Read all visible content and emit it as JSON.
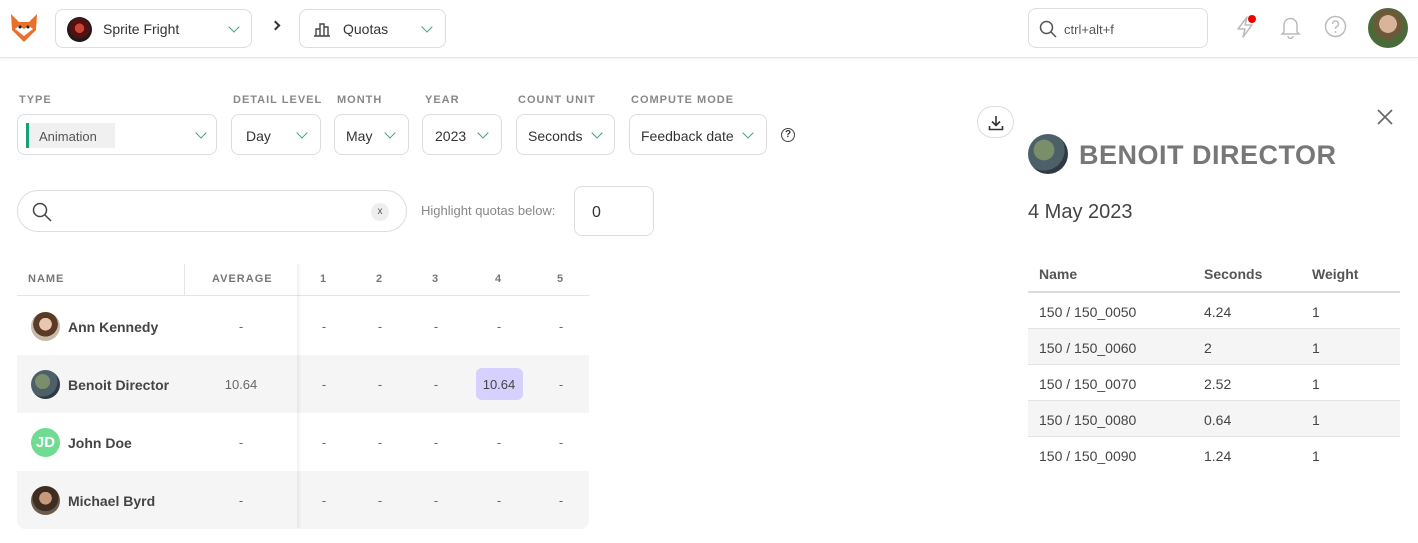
{
  "topbar": {
    "production": "Sprite Fright",
    "section": "Quotas",
    "search_placeholder": "ctrl+alt+f"
  },
  "filters": {
    "type": {
      "label": "TYPE",
      "value": "Animation"
    },
    "detail_level": {
      "label": "DETAIL LEVEL",
      "value": "Day"
    },
    "month": {
      "label": "MONTH",
      "value": "May"
    },
    "year": {
      "label": "YEAR",
      "value": "2023"
    },
    "count_unit": {
      "label": "COUNT UNIT",
      "value": "Seconds"
    },
    "compute_mode": {
      "label": "COMPUTE MODE",
      "value": "Feedback date"
    },
    "help": "?"
  },
  "search": {
    "clear": "x"
  },
  "highlight": {
    "label": "Highlight quotas below:",
    "value": "0"
  },
  "table": {
    "headers": {
      "name": "NAME",
      "average": "AVERAGE",
      "days": [
        "1",
        "2",
        "3",
        "4",
        "5"
      ]
    },
    "rows": [
      {
        "name": "Ann Kennedy",
        "average": "-",
        "days": [
          "-",
          "-",
          "-",
          "-",
          "-"
        ]
      },
      {
        "name": "Benoit Director",
        "average": "10.64",
        "days": [
          "-",
          "-",
          "-",
          "10.64",
          "-"
        ]
      },
      {
        "name": "John Doe",
        "initials": "JD",
        "average": "-",
        "days": [
          "-",
          "-",
          "-",
          "-",
          "-"
        ]
      },
      {
        "name": "Michael Byrd",
        "average": "-",
        "days": [
          "-",
          "-",
          "-",
          "-",
          "-"
        ]
      }
    ]
  },
  "panel": {
    "title": "BENOIT DIRECTOR",
    "date": "4 May 2023",
    "headers": {
      "name": "Name",
      "seconds": "Seconds",
      "weight": "Weight"
    },
    "rows": [
      {
        "name": "150 / 150_0050",
        "seconds": "4.24",
        "weight": "1"
      },
      {
        "name": "150 / 150_0060",
        "seconds": "2",
        "weight": "1"
      },
      {
        "name": "150 / 150_0070",
        "seconds": "2.52",
        "weight": "1"
      },
      {
        "name": "150 / 150_0080",
        "seconds": "0.64",
        "weight": "1"
      },
      {
        "name": "150 / 150_0090",
        "seconds": "1.24",
        "weight": "1"
      }
    ]
  },
  "colors": {
    "accent": "#13a07b",
    "highlight": "#d6d0ff",
    "notification": "#e00000"
  }
}
